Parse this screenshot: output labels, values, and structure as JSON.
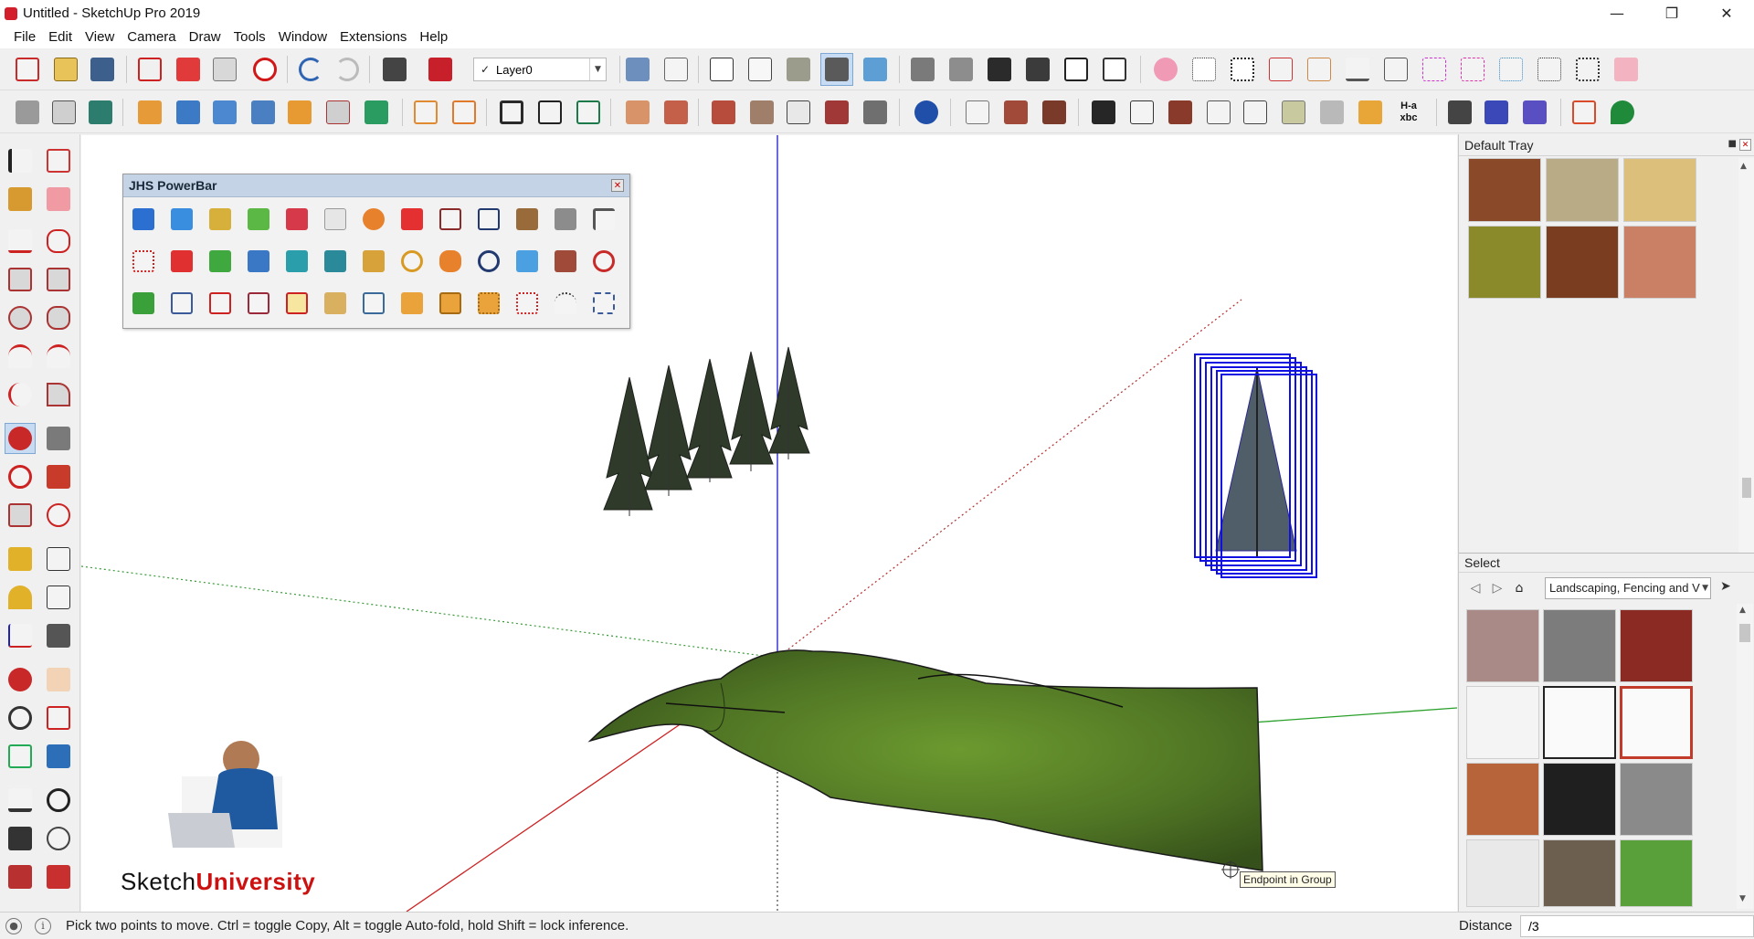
{
  "window": {
    "title": "Untitled - SketchUp Pro 2019"
  },
  "menu": [
    "File",
    "Edit",
    "View",
    "Camera",
    "Draw",
    "Tools",
    "Window",
    "Extensions",
    "Help"
  ],
  "layer_selector": {
    "value": "Layer0"
  },
  "powerbar": {
    "title": "JHS PowerBar"
  },
  "viewport": {
    "tooltip": "Endpoint in Group",
    "watermark_left": "Sketch",
    "watermark_right": "University"
  },
  "tray": {
    "title": "Default Tray",
    "select_label": "Select",
    "collection": "Landscaping, Fencing and V"
  },
  "status": {
    "message": "Pick two points to move.  Ctrl = toggle Copy, Alt = toggle Auto-fold, hold Shift = lock inference.",
    "measurement_label": "Distance",
    "measurement_value": "/3"
  },
  "toolbar2_text_icon": "H-a xbc",
  "colors": {
    "x_axis": "#cc2222",
    "y_axis": "#22aa22",
    "z_axis": "#1a1acc",
    "terrain": "#4f7424",
    "selection": "#1010e0",
    "watermark_accent": "#cc1111"
  }
}
